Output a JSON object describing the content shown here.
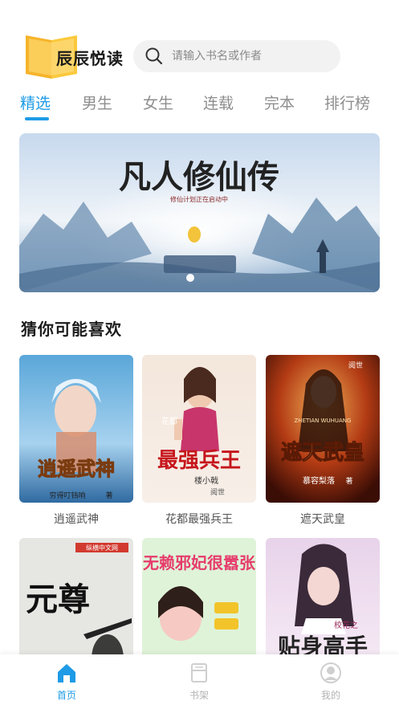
{
  "app": {
    "name": "辰辰悦读"
  },
  "search": {
    "placeholder": "请输入书名或作者"
  },
  "tabs": [
    {
      "label": "精选",
      "active": true
    },
    {
      "label": "男生",
      "active": false
    },
    {
      "label": "女生",
      "active": false
    },
    {
      "label": "连载",
      "active": false
    },
    {
      "label": "完本",
      "active": false
    },
    {
      "label": "排行榜",
      "active": false
    }
  ],
  "banner": {
    "title": "凡人修仙传",
    "subtitle": "修仙计划正在启动中"
  },
  "section": {
    "title": "猜你可能喜欢"
  },
  "books": [
    {
      "title": "逍遥武神",
      "cover_text": "逍遥武神",
      "cover_author": "穷得叮铛响",
      "cover_tag": "著",
      "cover_brand": ""
    },
    {
      "title": "花都最强兵王",
      "cover_text": "最强兵王",
      "cover_author": "楼小戟",
      "cover_tag": "花都",
      "cover_brand": "阅世"
    },
    {
      "title": "遮天武皇",
      "cover_text": "遮天武皇",
      "cover_author": "慕容梨落",
      "cover_tag": "著",
      "cover_brand": "阅世",
      "cover_pinyin": "ZHETIAN WUHUANG"
    },
    {
      "title": "",
      "cover_text": "元尊",
      "cover_author": "",
      "cover_tag": "",
      "cover_brand": "纵横中文网"
    },
    {
      "title": "",
      "cover_text": "无赖邪妃很嚣张",
      "cover_author": "",
      "cover_tag": "",
      "cover_brand": ""
    },
    {
      "title": "",
      "cover_text": "贴身高手",
      "cover_author": "",
      "cover_tag": "校花之",
      "cover_brand": ""
    }
  ],
  "nav": [
    {
      "label": "首页",
      "icon": "home-icon",
      "active": true
    },
    {
      "label": "书架",
      "icon": "bookshelf-icon",
      "active": false
    },
    {
      "label": "我的",
      "icon": "profile-icon",
      "active": false
    }
  ],
  "colors": {
    "accent": "#1e9be6",
    "tab_inactive": "#8e8e8e",
    "search_bg": "#f2f2f2"
  }
}
